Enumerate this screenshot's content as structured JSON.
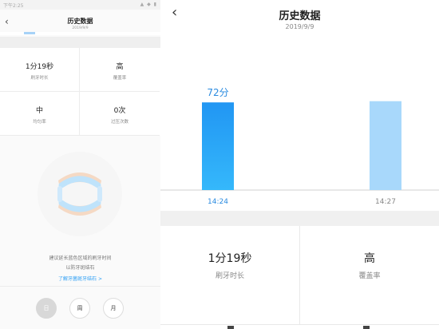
{
  "left": {
    "status": {
      "time": "下午2:25",
      "icons": "▲ ◆ ▮"
    },
    "header": {
      "back_icon": "chevron-left-icon",
      "title": "历史数据",
      "date": "2019/9/9"
    },
    "stats": [
      {
        "value": "1分19秒",
        "label": "刷牙时长"
      },
      {
        "value": "高",
        "label": "覆盖率"
      },
      {
        "value": "中",
        "label": "均匀率"
      },
      {
        "value": "0次",
        "label": "过压次数"
      }
    ],
    "tips": {
      "line1": "建议延长蓝色区域的刷牙时间",
      "line2": "以防牙斑结石",
      "link": "了解牙菌斑牙结石 >"
    },
    "tabs": [
      "日",
      "周",
      "月"
    ],
    "active_tab": "日"
  },
  "right": {
    "header": {
      "back_icon": "chevron-left-icon",
      "title": "历史数据",
      "date": "2019/9/9"
    },
    "stats": [
      {
        "value": "1分19秒",
        "label": "刷牙时长"
      },
      {
        "value": "高",
        "label": "覆盖率"
      }
    ]
  },
  "chart_data": {
    "type": "bar",
    "categories": [
      "14:24",
      "14:27"
    ],
    "values": [
      72,
      73
    ],
    "data_labels": [
      "72分",
      ""
    ],
    "selected_index": 0,
    "ylim": [
      0,
      100
    ],
    "grid": false,
    "colors": {
      "selected": "#2196f3",
      "selected_light": "#35b8fb",
      "normal": "#a8d8fb",
      "axis": "#d0d0d0",
      "label_selected": "#2a8be0",
      "label_normal": "#888888"
    }
  }
}
